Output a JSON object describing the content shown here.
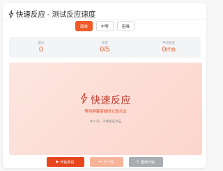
{
  "header": {
    "title_prefix": "快速反应",
    "title_suffix": " - 测试反应速度"
  },
  "modes": [
    {
      "label": "简单",
      "active": true
    },
    {
      "label": "中等",
      "active": false
    },
    {
      "label": "困难",
      "active": false
    }
  ],
  "stats": [
    {
      "label": "得分",
      "value": "0"
    },
    {
      "label": "轮次",
      "value": "0/5"
    },
    {
      "label": "平均反应",
      "value": "0ms"
    }
  ],
  "arena": {
    "title": "快速反应",
    "subtitle": "等待屏幕变绿时立即点击",
    "hint": "共 5 轮，不要提前点击"
  },
  "buttons": {
    "start": "开始测试",
    "next": "下一轮",
    "restart": "重新开始"
  },
  "colors": {
    "accent": "#f05a28",
    "arena_bg": "#fde6e0"
  }
}
